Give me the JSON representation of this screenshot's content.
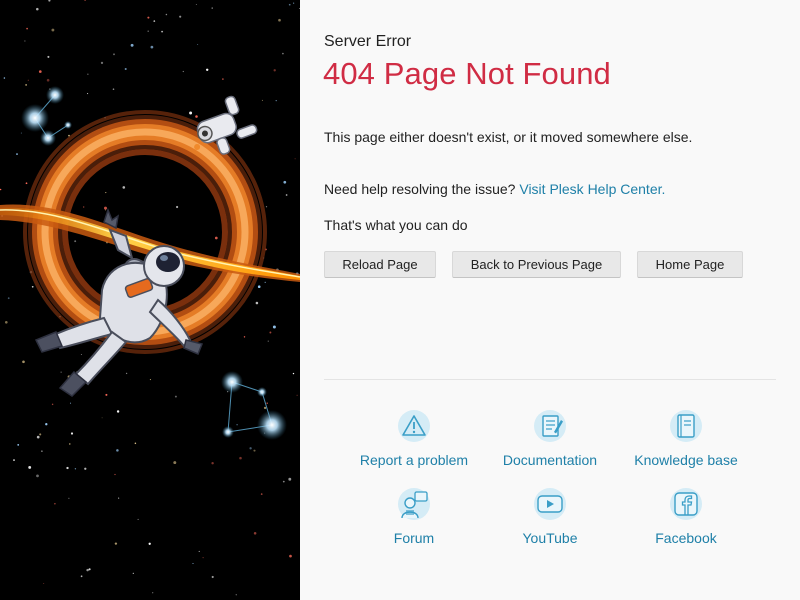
{
  "header": {
    "eyebrow": "Server Error",
    "title": "404 Page Not Found"
  },
  "messages": {
    "not_exist": "This page either doesn't exist, or it moved somewhere else.",
    "help_prefix": "Need help resolving the issue?",
    "help_link": "Visit Plesk Help Center.",
    "what_you_can_do": "That's what you can do"
  },
  "actions": {
    "reload": "Reload Page",
    "back": "Back to Previous Page",
    "home": "Home Page"
  },
  "links": {
    "report": {
      "label": "Report a problem",
      "icon": "warning-icon"
    },
    "docs": {
      "label": "Documentation",
      "icon": "document-icon"
    },
    "kb": {
      "label": "Knowledge base",
      "icon": "book-icon"
    },
    "forum": {
      "label": "Forum",
      "icon": "forum-icon"
    },
    "youtube": {
      "label": "YouTube",
      "icon": "youtube-icon"
    },
    "facebook": {
      "label": "Facebook",
      "icon": "facebook-icon"
    }
  },
  "colors": {
    "title": "#d02c44",
    "link": "#1f80a8",
    "icon_bg": "#d5ecf6",
    "icon_stroke": "#3a9ec7"
  }
}
